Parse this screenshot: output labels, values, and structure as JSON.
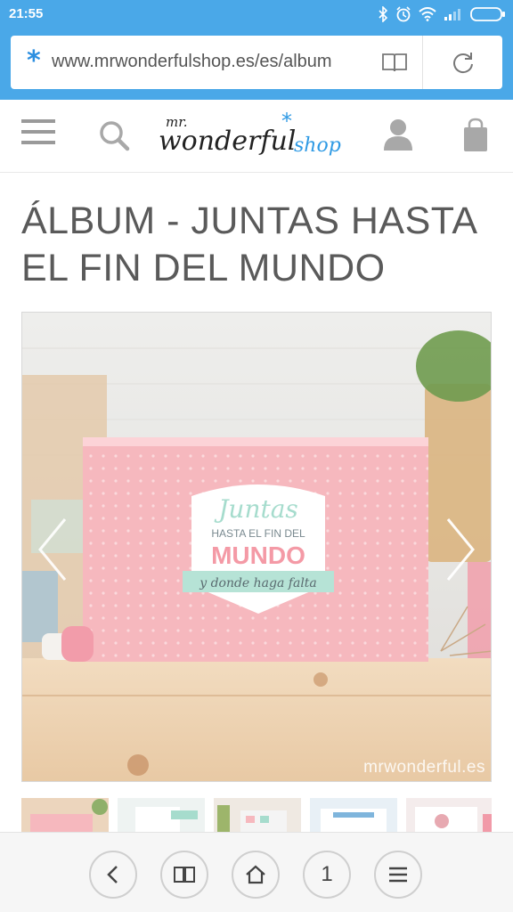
{
  "status_bar": {
    "time": "21:55",
    "icons": [
      "bluetooth-icon",
      "alarm-icon",
      "wifi-icon",
      "signal-icon",
      "battery-icon"
    ]
  },
  "browser": {
    "url": "www.mrwonderfulshop.es/es/album",
    "secure_icon": "star-icon"
  },
  "site_header": {
    "logo_text": "mr. wonderful shop",
    "icons": [
      "menu-icon",
      "search-icon",
      "user-icon",
      "cart-icon"
    ]
  },
  "product": {
    "title": "ÁLBUM - JUNTAS HASTA EL FIN DEL MUNDO",
    "image_watermark": "mrwonderful.es",
    "box_label": {
      "line1": "Juntas",
      "line2": "HASTA EL FIN DEL",
      "line3": "MUNDO",
      "ribbon": "y donde haga falta"
    },
    "thumbnail_count": 5
  },
  "bottom_nav": {
    "tab_count": "1",
    "buttons": [
      "back-icon",
      "bookmarks-icon",
      "home-icon",
      "tabs-icon",
      "menu-icon"
    ]
  },
  "colors": {
    "browser_bar": "#4aa8e8",
    "title_text": "#5a5a5a",
    "box_pink": "#f6b7bd",
    "mint": "#a6dccd"
  }
}
